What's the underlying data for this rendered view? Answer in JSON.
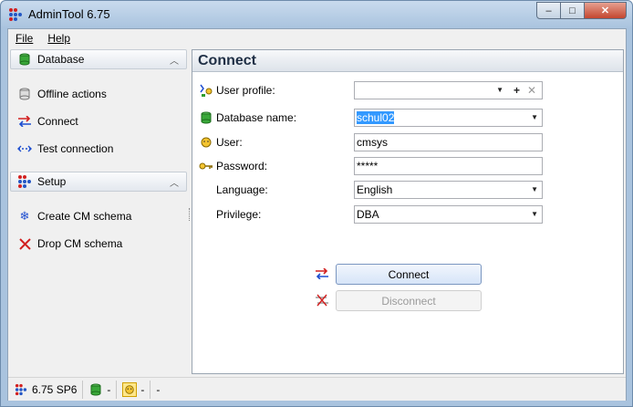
{
  "window": {
    "title": "AdminTool 6.75",
    "minimize": "–",
    "maximize": "□",
    "close": "✕"
  },
  "menu": [
    {
      "label": "File"
    },
    {
      "label": "Help"
    }
  ],
  "sidebar": {
    "groups": [
      {
        "label": "Database",
        "icon": "database-icon",
        "items": [
          {
            "label": "Offline actions",
            "icon": "database-offline-icon"
          },
          {
            "label": "Connect",
            "icon": "connect-arrows-icon"
          },
          {
            "label": "Test connection",
            "icon": "test-connection-icon"
          }
        ]
      },
      {
        "label": "Setup",
        "icon": "setup-icon",
        "items": [
          {
            "label": "Create CM schema",
            "icon": "snowflake-icon"
          },
          {
            "label": "Drop CM schema",
            "icon": "red-x-icon"
          }
        ]
      }
    ]
  },
  "main": {
    "title": "Connect",
    "fields": {
      "user_profile": {
        "label": "User profile:",
        "value": ""
      },
      "database_name": {
        "label": "Database name:",
        "value": "schul02"
      },
      "user": {
        "label": "User:",
        "value": "cmsys"
      },
      "password": {
        "label": "Password:",
        "value": "*****"
      },
      "language": {
        "label": "Language:",
        "value": "English"
      },
      "privilege": {
        "label": "Privilege:",
        "value": "DBA"
      }
    },
    "buttons": {
      "connect": "Connect",
      "disconnect": "Disconnect"
    }
  },
  "statusbar": {
    "version": "6.75 SP6",
    "db_status": "-",
    "user_status": "-",
    "extra": "-"
  },
  "colors": {
    "accent": "#3399ff",
    "database_green": "#2e9e2e",
    "connect_red": "#d22020",
    "connect_blue": "#1f4fd0"
  }
}
